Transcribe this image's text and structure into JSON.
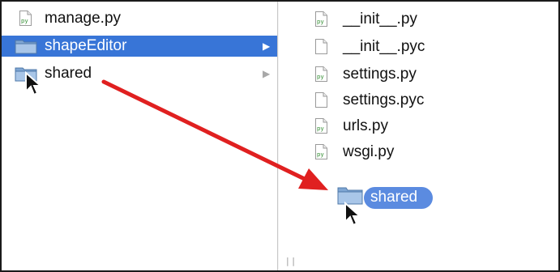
{
  "left_column": {
    "items": [
      {
        "label": "manage.py",
        "icon": "python-file-icon",
        "selected": false
      },
      {
        "label": "shapeEditor",
        "icon": "folder-icon",
        "selected": true,
        "has_children": true
      },
      {
        "label": "shared",
        "icon": "folder-icon",
        "selected": false,
        "has_children": true
      }
    ]
  },
  "right_column": {
    "items": [
      {
        "label": "__init__.py",
        "icon": "python-file-icon"
      },
      {
        "label": "__init__.pyc",
        "icon": "blank-file-icon"
      },
      {
        "label": "settings.py",
        "icon": "python-file-icon"
      },
      {
        "label": "settings.pyc",
        "icon": "blank-file-icon"
      },
      {
        "label": "urls.py",
        "icon": "python-file-icon"
      },
      {
        "label": "wsgi.py",
        "icon": "python-file-icon"
      }
    ],
    "drag_preview": {
      "label": "shared",
      "icon": "folder-icon"
    }
  },
  "icon_text": {
    "python_badge": "py"
  },
  "colors": {
    "selection": "#3875d7",
    "drag_pill": "#5b8be0",
    "arrow": "#e02020",
    "folder_body": "#8fb1d6"
  }
}
